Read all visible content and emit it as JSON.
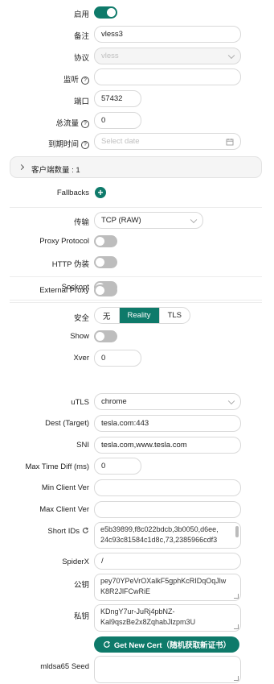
{
  "enable": {
    "label": "启用",
    "on": true
  },
  "remark": {
    "label": "备注",
    "value": "vless3"
  },
  "protocol": {
    "label": "协议",
    "value": "vless"
  },
  "listen": {
    "label": "监听",
    "value": ""
  },
  "port": {
    "label": "端口",
    "value": "57432"
  },
  "total_traffic": {
    "label": "总流量",
    "value": "0"
  },
  "expiry": {
    "label": "到期时间",
    "placeholder": "Select date"
  },
  "clients": {
    "label": "客户端数量 : 1"
  },
  "fallbacks": {
    "label": "Fallbacks"
  },
  "transport": {
    "label": "传输",
    "value": "TCP (RAW)"
  },
  "proxy_protocol": {
    "label": "Proxy Protocol",
    "on": false
  },
  "http_camouflage": {
    "label": "HTTP 伪装",
    "on": false
  },
  "sockopt": {
    "label": "Sockopt",
    "on": false
  },
  "external_proxy": {
    "label": "External Proxy",
    "on": false
  },
  "security": {
    "label": "安全",
    "options": [
      "无",
      "Reality",
      "TLS"
    ],
    "selected": "Reality"
  },
  "show": {
    "label": "Show",
    "on": false
  },
  "xver": {
    "label": "Xver",
    "value": "0"
  },
  "utls": {
    "label": "uTLS",
    "value": "chrome"
  },
  "dest": {
    "label": "Dest (Target)",
    "value": "tesla.com:443"
  },
  "sni": {
    "label": "SNI",
    "value": "tesla.com,www.tesla.com"
  },
  "max_time_diff": {
    "label": "Max Time Diff (ms)",
    "value": "0"
  },
  "min_client_ver": {
    "label": "Min Client Ver",
    "value": ""
  },
  "max_client_ver": {
    "label": "Max Client Ver",
    "value": ""
  },
  "short_ids": {
    "label": "Short IDs",
    "line1": "e5b39899,f8c022bdcb,3b0050,d6ee,",
    "line2": "24c93c81584c1d8c,73,2385966cdf3"
  },
  "spider_x": {
    "label": "SpiderX",
    "value": "/"
  },
  "public_key": {
    "label": "公钥",
    "line1": "pey70YPeVrOXalkF5gphKcRIDqOqJlw",
    "line2": "K8R2JlFCwRiE"
  },
  "private_key": {
    "label": "私钥",
    "line1": "KDngY7ur-JuRj4pbNZ-",
    "line2": "Kal9qszBe2x8ZqhabJlzpm3U"
  },
  "get_cert_button": {
    "label": "Get New Cert（随机获取新证书）"
  },
  "mldsa65_seed": {
    "label": "mldsa65 Seed",
    "value": ""
  },
  "colors": {
    "accent": "#0e7a6a",
    "toggle_off": "#bdbdbd",
    "border": "#d9d9d9"
  }
}
